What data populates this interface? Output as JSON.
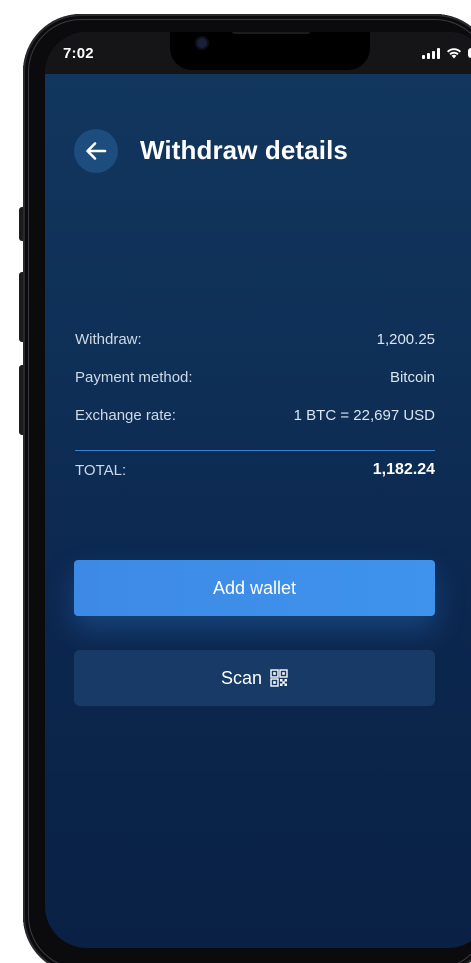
{
  "status_bar": {
    "time": "7:02",
    "icons": [
      "signal-icon",
      "wifi-icon",
      "battery-icon"
    ]
  },
  "header": {
    "back_icon": "arrow-left-icon",
    "title": "Withdraw details"
  },
  "details": [
    {
      "label": "Withdraw:",
      "value": "1,200.25"
    },
    {
      "label": "Payment method:",
      "value": "Bitcoin"
    },
    {
      "label": "Exchange rate:",
      "value": "1 BTC = 22,697 USD"
    }
  ],
  "total": {
    "label": "TOTAL:",
    "value": "1,182.24"
  },
  "buttons": {
    "add_wallet": "Add wallet",
    "scan": "Scan",
    "scan_icon": "qr-code-icon"
  },
  "colors": {
    "background_top": "#12375f",
    "background_bottom": "#0a2145",
    "accent": "#3d8ae6",
    "secondary_button": "#173b66",
    "divider": "#3a84d6"
  }
}
